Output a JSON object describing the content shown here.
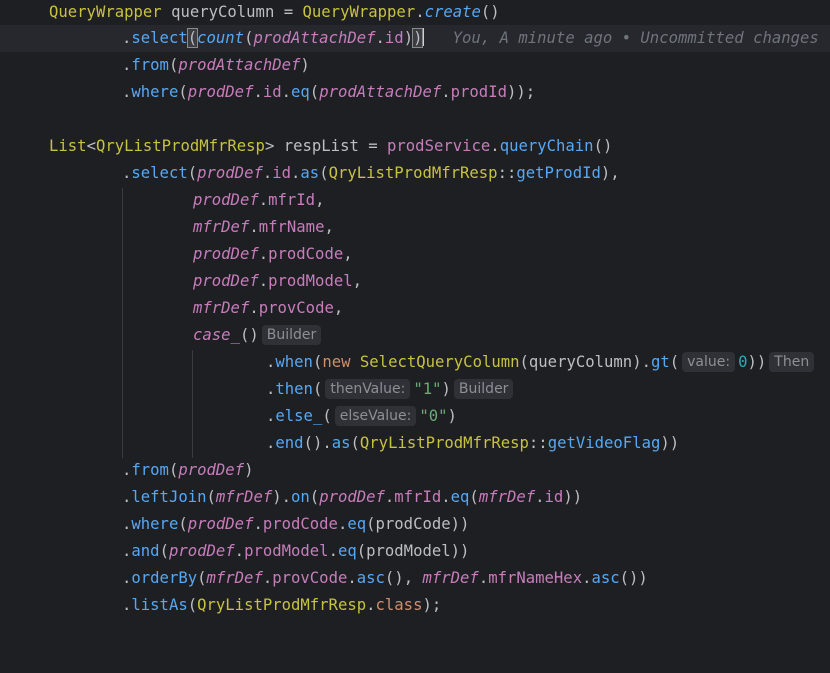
{
  "blame": "You, A minute ago • Uncommitted changes",
  "hints": {
    "builder1": "Builder",
    "value_param": "value:",
    "then_hint": "Then",
    "then_value_param": "thenValue:",
    "builder2": "Builder",
    "else_value_param": "elseValue:"
  },
  "tokens": {
    "QueryWrapper": "QueryWrapper",
    "queryColumn": "queryColumn",
    "eq_sign": " = ",
    "dot": ".",
    "create": "create",
    "parens_empty": "()",
    "select": "select",
    "count": "count",
    "prodAttachDef": "prodAttachDef",
    "id": "id",
    "from": "from",
    "where": "where",
    "prodDef": "prodDef",
    "eq": "eq",
    "prodId": "prodId",
    "List": "List",
    "QryListProdMfrResp": "QryListProdMfrResp",
    "respList": "respList",
    "prodService": "prodService",
    "queryChain": "queryChain",
    "as": "as",
    "getProdId": "getProdId",
    "mfrId": "mfrId",
    "mfrDef": "mfrDef",
    "mfrName": "mfrName",
    "prodCode": "prodCode",
    "prodModel": "prodModel",
    "provCode": "provCode",
    "case_": "case_",
    "when": "when",
    "new": "new",
    "SelectQueryColumn": "SelectQueryColumn",
    "gt": "gt",
    "zero_num": "0",
    "then": "then",
    "str1": "\"1\"",
    "else_": "else_",
    "str0": "\"0\"",
    "end": "end",
    "getVideoFlag": "getVideoFlag",
    "leftJoin": "leftJoin",
    "on": "on",
    "and": "and",
    "orderBy": "orderBy",
    "asc": "asc",
    "mfrNameHex": "mfrNameHex",
    "listAs": "listAs",
    "class": "class"
  }
}
